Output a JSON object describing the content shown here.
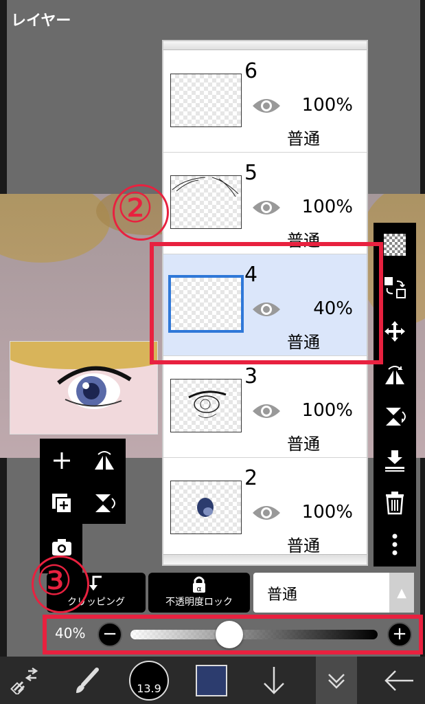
{
  "title": "レイヤー",
  "layers": [
    {
      "number": "6",
      "opacity": "100%",
      "blend": "普通",
      "selected": false
    },
    {
      "number": "5",
      "opacity": "100%",
      "blend": "普通",
      "selected": false
    },
    {
      "number": "4",
      "opacity": "40%",
      "blend": "普通",
      "selected": true
    },
    {
      "number": "3",
      "opacity": "100%",
      "blend": "普通",
      "selected": false
    },
    {
      "number": "2",
      "opacity": "100%",
      "blend": "普通",
      "selected": false
    }
  ],
  "annotations": {
    "two": "②",
    "three": "③"
  },
  "bottom_controls": {
    "clipping_label": "クリッピング",
    "alpha_lock_label": "不透明度ロック",
    "blend_mode": "普通",
    "opacity_label": "40%",
    "opacity_value": 0.4
  },
  "brush_size": "13.9",
  "colors": {
    "accent_red": "#e8213f",
    "selection_blue": "#2f78d8",
    "current_color": "#2c3c6e"
  }
}
